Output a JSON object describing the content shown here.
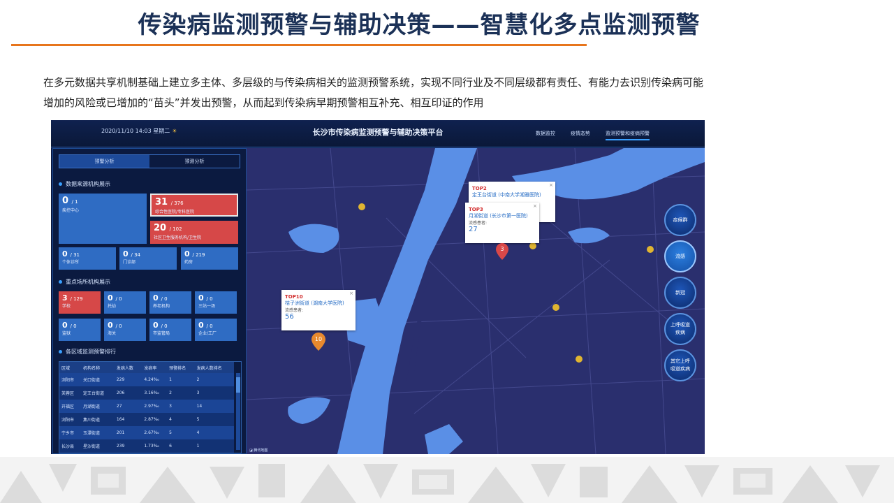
{
  "slide": {
    "title": "传染病监测预警与辅助决策——智慧化多点监测预警",
    "intro_line1": "在多元数据共享机制基础上建立多主体、多层级的与传染病相关的监测预警系统，实现不同行业及不同层级都有责任、有能力去识别传染病可能",
    "intro_line2": "增加的风险或已增加的“苗头”并发出预警，从而起到传染病早期预警相互补充、相互印证的作用"
  },
  "dashboard": {
    "datetime": "2020/11/10  14:03  星期二",
    "title": "长沙市传染病监测预警与辅助决策平台",
    "nav": [
      "数据监控",
      "疫情态势",
      "监测预警和疫病预警"
    ],
    "tabs": [
      "预警分析",
      "预测分析"
    ],
    "section_sources": "数据来源机构展示",
    "section_venues": "重点场所机构展示",
    "section_ranking": "各区域监测预警排行",
    "source_cards": [
      {
        "value": "0",
        "total": "/ 1",
        "label": "疾控中心"
      },
      {
        "value": "31",
        "total": "/ 376",
        "label": "综合性医院/专科医院"
      },
      {
        "value": "20",
        "total": "/ 102",
        "label": "社区卫生服务机构/卫生院"
      },
      {
        "value": "0",
        "total": "/ 31",
        "label": "个体诊所"
      },
      {
        "value": "0",
        "total": "/ 34",
        "label": "门诊部"
      },
      {
        "value": "0",
        "total": "/ 219",
        "label": "药房"
      }
    ],
    "venue_cards": [
      {
        "value": "3",
        "total": "/ 129",
        "label": "学校"
      },
      {
        "value": "0",
        "total": "/ 0",
        "label": "托幼"
      },
      {
        "value": "0",
        "total": "/ 0",
        "label": "养老机构"
      },
      {
        "value": "0",
        "total": "/ 0",
        "label": "三站一场"
      },
      {
        "value": "0",
        "total": "/ 0",
        "label": "监狱"
      },
      {
        "value": "0",
        "total": "/ 0",
        "label": "海关"
      },
      {
        "value": "0",
        "total": "/ 0",
        "label": "市监管局"
      },
      {
        "value": "0",
        "total": "/ 0",
        "label": "企业/工厂"
      }
    ],
    "ranking": {
      "headers": [
        "区域",
        "机构名称",
        "发病人数",
        "发病率",
        "预警排名",
        "发病人数排名"
      ],
      "rows": [
        [
          "浏阳市",
          "关口街道",
          "229",
          "4.24‰",
          "1",
          "2"
        ],
        [
          "芙蓉区",
          "定王台街道",
          "206",
          "3.16‰",
          "2",
          "3"
        ],
        [
          "开福区",
          "月湖街道",
          "27",
          "2.97‰",
          "3",
          "14"
        ],
        [
          "浏阳市",
          "集川街道",
          "164",
          "2.87‰",
          "4",
          "5"
        ],
        [
          "宁乡市",
          "玉潭街道",
          "201",
          "2.67‰",
          "5",
          "4"
        ],
        [
          "长沙县",
          "星沙街道",
          "239",
          "1.73‰",
          "6",
          "1"
        ]
      ]
    },
    "popups": [
      {
        "rank": "TOP2",
        "station": "定王台街道 (中南大学湘雅医院)"
      },
      {
        "rank": "TOP3",
        "station": "月湖街道 (长沙市第一医院)",
        "caption": "流感患者:",
        "value": "27"
      },
      {
        "rank": "TOP10",
        "station": "桔子洲街道 (湖南大学医院)",
        "caption": "流感患者:",
        "value": "56"
      }
    ],
    "markers": [
      "3",
      "10"
    ],
    "disease_buttons": [
      "症候群",
      "流感",
      "新冠",
      "上呼吸道疾病",
      "其它上呼吸道疾病"
    ],
    "map_footer": "腾讯地图"
  },
  "colors": {
    "title": "#1b3157",
    "accent_rule": "#e7751c",
    "alert_card": "#d64848",
    "normal_card": "#2f6cc3",
    "map_land": "#2a2f6e",
    "river": "#5a8fe6"
  }
}
